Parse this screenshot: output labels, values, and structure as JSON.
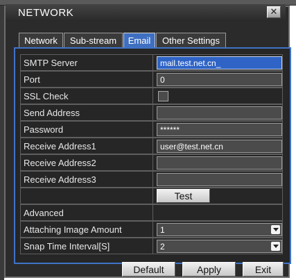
{
  "window": {
    "title": "NETWORK",
    "close_symbol": "✕"
  },
  "tabs": [
    {
      "label": "Network",
      "active": false
    },
    {
      "label": "Sub-stream",
      "active": false
    },
    {
      "label": "Email",
      "active": true
    },
    {
      "label": "Other Settings",
      "active": false
    }
  ],
  "form": {
    "smtp_server": {
      "label": "SMTP Server",
      "value": "mail.test.net.cn_"
    },
    "port": {
      "label": "Port",
      "value": "0"
    },
    "ssl_check": {
      "label": "SSL Check",
      "checked": false
    },
    "send_address": {
      "label": "Send Address",
      "value": ""
    },
    "password": {
      "label": "Password",
      "value": "******"
    },
    "receive_address1": {
      "label": "Receive Address1",
      "value": "user@test.net.cn"
    },
    "receive_address2": {
      "label": "Receive Address2",
      "value": ""
    },
    "receive_address3": {
      "label": "Receive Address3",
      "value": ""
    },
    "test_button": "Test",
    "advanced": {
      "label": "Advanced"
    },
    "attaching_image_amount": {
      "label": "Attaching Image Amount",
      "value": "1"
    },
    "snap_time_interval": {
      "label": "Snap Time Interval[S]",
      "value": "2"
    }
  },
  "footer": {
    "default_label": "Default",
    "apply_label": "Apply",
    "exit_label": "Exit"
  },
  "colors": {
    "accent": "#3f6fc1",
    "focused_field": "#2f64c6",
    "background": "#2b2b2b"
  }
}
